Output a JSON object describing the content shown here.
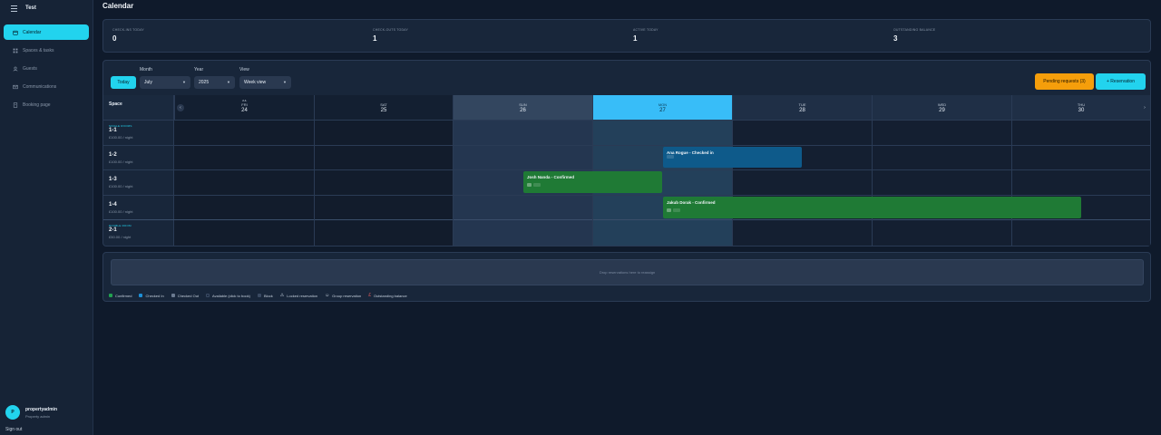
{
  "sidebar": {
    "brand": "Test",
    "nav": [
      {
        "label": "Calendar",
        "icon": "calendar-icon",
        "active": true
      },
      {
        "label": "Spaces & tasks",
        "icon": "grid-icon",
        "active": false
      },
      {
        "label": "Guests",
        "icon": "user-icon",
        "active": false
      },
      {
        "label": "Communications",
        "icon": "mail-icon",
        "active": false
      },
      {
        "label": "Booking page",
        "icon": "page-icon",
        "active": false
      }
    ],
    "user": {
      "initial": "P",
      "name": "propertyadmin",
      "role": "Property admin"
    },
    "signout": "Sign out"
  },
  "page": {
    "title": "Calendar"
  },
  "stats": [
    {
      "label": "CHECK-INS TODAY",
      "value": "0"
    },
    {
      "label": "CHECK-OUTS TODAY",
      "value": "1"
    },
    {
      "label": "ACTIVE TODAY",
      "value": "1"
    },
    {
      "label": "OUTSTANDING BALANCE",
      "value": "3"
    }
  ],
  "controls": {
    "month_label": "Month",
    "year_label": "Year",
    "view_label": "View",
    "today": "Today",
    "month_value": "July",
    "year_value": "2025",
    "view_value": "Week view",
    "pending": "Pending requests (3)",
    "reservation": "+ Reservation"
  },
  "grid": {
    "space_header": "Space",
    "days": [
      {
        "month": "JUL",
        "name": "FRI",
        "num": "24"
      },
      {
        "month": "",
        "name": "SAT",
        "num": "25"
      },
      {
        "month": "",
        "name": "SUN",
        "num": "26"
      },
      {
        "month": "",
        "name": "MON",
        "num": "27"
      },
      {
        "month": "",
        "name": "TUE",
        "num": "28"
      },
      {
        "month": "",
        "name": "WED",
        "num": "29"
      },
      {
        "month": "",
        "name": "THU",
        "num": "30"
      }
    ],
    "rows": [
      {
        "category": "SINGLE ROOMS",
        "room": "1-1",
        "price": "£100.00 / night"
      },
      {
        "category": "",
        "room": "1-2",
        "price": "£100.00 / night"
      },
      {
        "category": "",
        "room": "1-3",
        "price": "£100.00 / night"
      },
      {
        "category": "",
        "room": "1-4",
        "price": "£100.00 / night"
      },
      {
        "category": "DOUBLE ROOM",
        "room": "2-1",
        "price": "£50.00 / night"
      }
    ],
    "reservations": [
      {
        "label": "Ana Rogue - Checked in",
        "color": "#0e5a8a"
      },
      {
        "label": "Josh Nanda - Confirmed",
        "color": "#1f7a35"
      },
      {
        "label": "Jakub Dorak - Confirmed",
        "color": "#1f7a35"
      }
    ]
  },
  "dropzone": "Drop reservations here to reassign",
  "legend": [
    {
      "label": "Confirmed",
      "color": "#22a150"
    },
    {
      "label": "Checked In",
      "color": "#1d8fd6"
    },
    {
      "label": "Checked Out",
      "color": "#6b7a90"
    },
    {
      "label": "Available (click to book)",
      "color": "#1e2d44"
    },
    {
      "label": "Block",
      "color": "#3a4a62"
    },
    {
      "label": "Locked reservation",
      "icon": "lock-icon"
    },
    {
      "label": "Group reservation",
      "icon": "group-icon"
    },
    {
      "label": "Outstanding balance",
      "icon": "balance-icon"
    }
  ]
}
